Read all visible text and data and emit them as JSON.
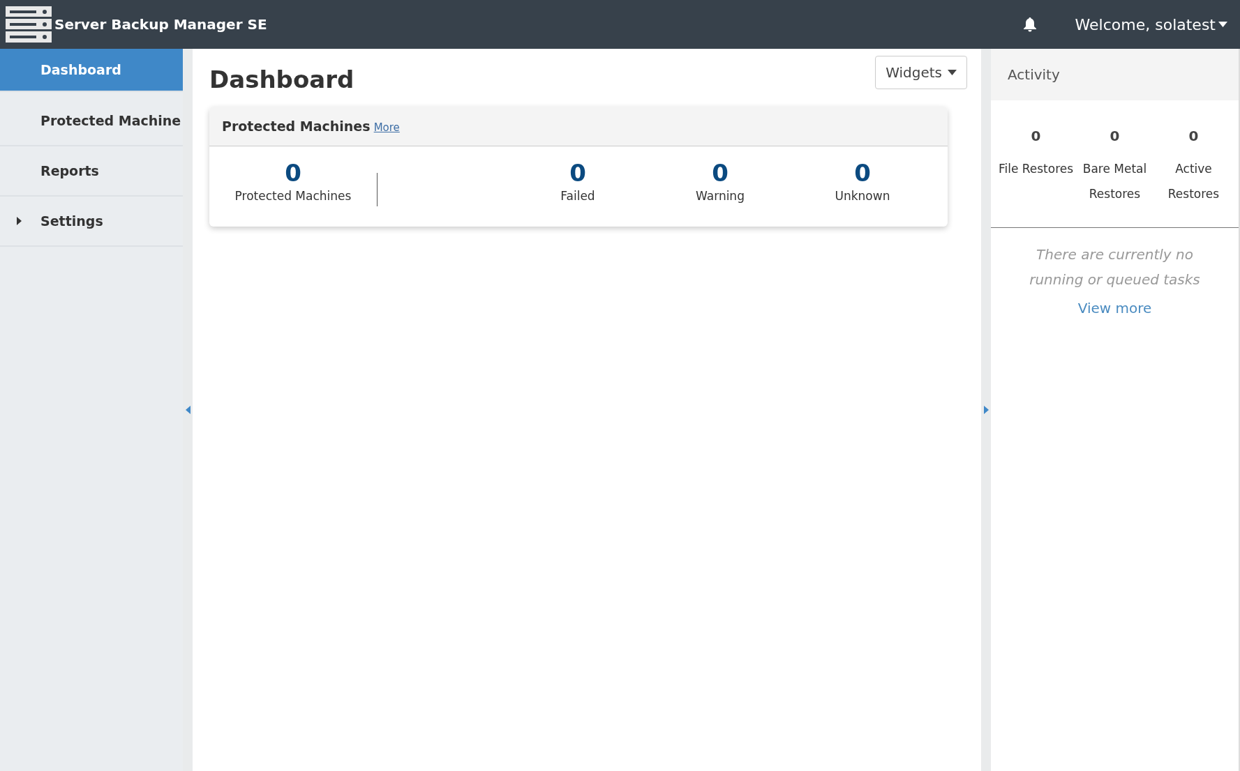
{
  "app": {
    "title": "Server Backup Manager SE",
    "user_menu": "Welcome, solatest"
  },
  "sidebar": {
    "items": [
      {
        "label": "Dashboard",
        "selected": true
      },
      {
        "label": "Protected Machine",
        "selected": false
      },
      {
        "label": "Reports",
        "selected": false
      },
      {
        "label": "Settings",
        "selected": false,
        "expanded": false
      }
    ]
  },
  "main": {
    "title": "Dashboard",
    "widgets_button": "Widgets",
    "widget": {
      "title": "Protected Machines",
      "link": "More",
      "total": {
        "value": "0",
        "label": "Protected Machines"
      },
      "stats": [
        {
          "value": "0",
          "label": "Failed"
        },
        {
          "value": "0",
          "label": "Warning"
        },
        {
          "value": "0",
          "label": "Unknown"
        }
      ]
    }
  },
  "activity": {
    "title": "Activity",
    "counters": [
      {
        "value": "0",
        "label": "File Restores"
      },
      {
        "value": "0",
        "label": "Bare Metal Restores"
      },
      {
        "value": "0",
        "label": "Active Restores"
      }
    ],
    "empty_message": "There are currently no running or queued tasks",
    "link": "View more"
  }
}
